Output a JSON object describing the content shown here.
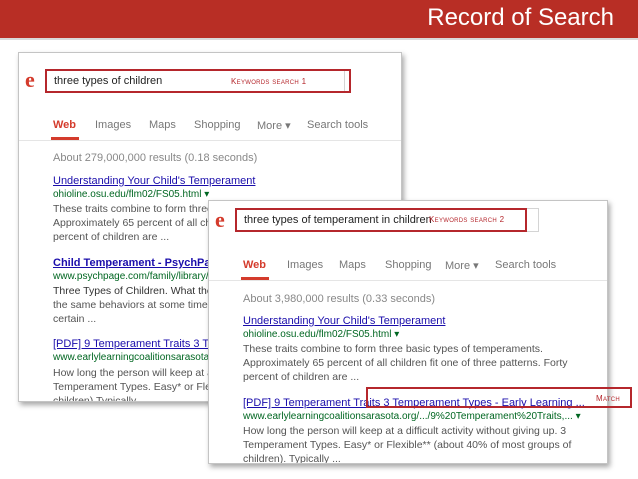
{
  "slide": {
    "title": "Record of Search"
  },
  "screenshot1": {
    "query": "three types of children",
    "annotation": "Keywords search 1",
    "tabs": [
      "Web",
      "Images",
      "Maps",
      "Shopping",
      "More ▾",
      "Search tools"
    ],
    "stats": "About 279,000,000 results (0.18 seconds)",
    "results": [
      {
        "title": "Understanding Your Child's Temperament",
        "url": "ohioline.osu.edu/flm02/FS05.html ▾",
        "snippet": [
          "These traits combine to form three",
          "Approximately 65 percent of all chil",
          "percent of children are ..."
        ]
      },
      {
        "title": "Child Temperament - PsychPage",
        "url": "www.psychpage.com/family/library/t",
        "snippet": [
          "Three Types of Children. What the",
          "the same behaviors at some time, so",
          "certain ..."
        ]
      },
      {
        "title": "[PDF] 9 Temperament Traits 3 Temp",
        "url": "www.earlylearningcoalitionsarasota.",
        "snippet": [
          "How long the person will keep at a d",
          "Temperament Types. Easy* or Flexibl",
          "children) Typically"
        ]
      }
    ]
  },
  "screenshot2": {
    "query": "three types of temperament in children",
    "annotation": "Keywords search 2",
    "tabs": [
      "Web",
      "Images",
      "Maps",
      "Shopping",
      "More ▾",
      "Search tools"
    ],
    "stats": "About 3,980,000 results (0.33 seconds)",
    "results": [
      {
        "title": "Understanding Your Child's Temperament",
        "url": "ohioline.osu.edu/flm02/FS05.html ▾",
        "snippet": [
          "These traits combine to form three basic types of temperaments.",
          "Approximately 65 percent of all children fit one of three patterns. Forty",
          "percent of children are ..."
        ]
      },
      {
        "title": "[PDF] 9 Temperament Traits 3 Temperament Types - Early Learning ...",
        "url": "www.earlylearningcoalitionsarasota.org/.../9%20Temperament%20Traits,... ▾",
        "snippet": [
          "How long the person will keep at a difficult activity without giving up. 3",
          "Temperament Types. Easy* or Flexible** (about 40% of most groups of",
          "children). Typically ..."
        ]
      }
    ],
    "match_label": "Match"
  }
}
